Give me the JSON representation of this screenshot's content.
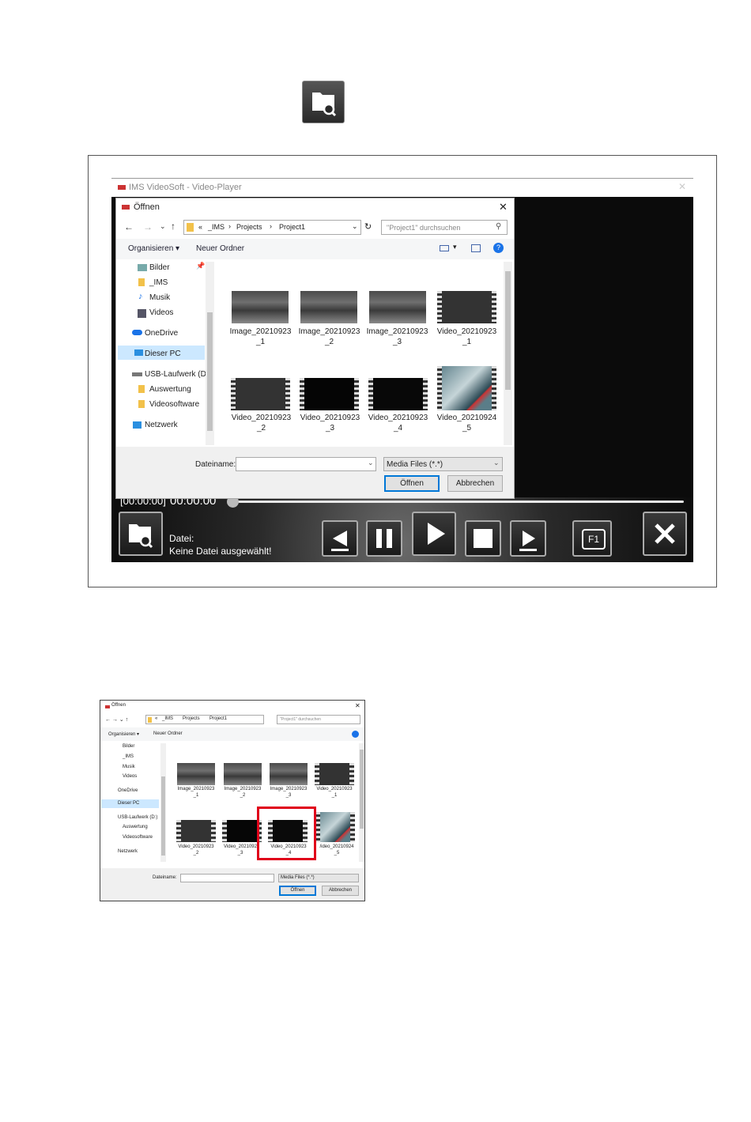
{
  "player": {
    "window_title": "IMS VideoSoft - Video-Player",
    "time_bracket": "[00:00:00]",
    "time_current": "00:00:00",
    "file_label": "Datei:",
    "file_value": "Keine Datei ausgewählt!",
    "f1_label": "F1"
  },
  "dialog": {
    "title": "Öffnen",
    "breadcrumb": [
      "«",
      "_IMS",
      "Projects",
      "Project1"
    ],
    "search_placeholder": "\"Project1\" durchsuchen",
    "toolbar": {
      "organize": "Organisieren ▾",
      "new_folder": "Neuer Ordner"
    },
    "nav": {
      "bilder": "Bilder",
      "ims": "_IMS",
      "musik": "Musik",
      "videos": "Videos",
      "onedrive": "OneDrive",
      "dieser_pc": "Dieser PC",
      "usb": "USB-Laufwerk (D:)",
      "auswertung": "Auswertung",
      "videosoftware": "Videosoftware",
      "netzwerk": "Netzwerk"
    },
    "files": [
      {
        "line1": "Image_20210923",
        "line2": "_1"
      },
      {
        "line1": "Image_20210923",
        "line2": "_2"
      },
      {
        "line1": "Image_20210923",
        "line2": "_3"
      },
      {
        "line1": "Video_20210923",
        "line2": "_1"
      },
      {
        "line1": "Video_20210923",
        "line2": "_2"
      },
      {
        "line1": "Video_20210923",
        "line2": "_3"
      },
      {
        "line1": "Video_20210923",
        "line2": "_4"
      },
      {
        "line1": "Video_20210924",
        "line2": "_5"
      }
    ],
    "filename_label": "Dateiname:",
    "filename_value": "",
    "filter": "Media Files (*.*)",
    "open_button": "Öffnen",
    "cancel_button": "Abbrechen"
  },
  "small_dialog": {
    "files": [
      {
        "line1": "Image_20210923",
        "line2": "_1"
      },
      {
        "line1": "Image_20210923",
        "line2": "_2"
      },
      {
        "line1": "Image_20210923",
        "line2": "_3"
      },
      {
        "line1": "Video_20210923",
        "line2": "_1"
      },
      {
        "line1": "Video_20210923",
        "line2": "_2"
      },
      {
        "line1": "Video_2021092",
        "line2": "_3"
      },
      {
        "line1": "Video_20210923",
        "line2": "_4"
      },
      {
        "line1": "/ideo_20210924",
        "line2": "_5"
      }
    ],
    "highlight_color": "#e0001a"
  }
}
